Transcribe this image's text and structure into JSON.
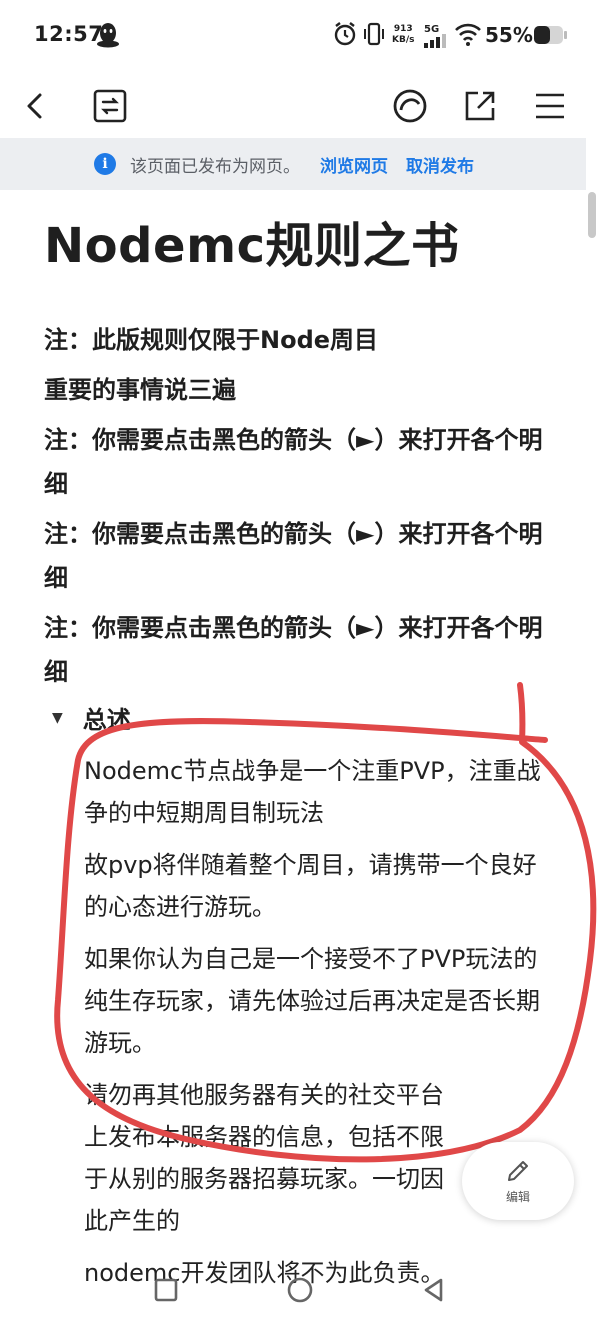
{
  "status_bar": {
    "time": "12:57",
    "net_speed": "913",
    "net_unit": "KB/s",
    "signal_label": "5G",
    "battery": "55%"
  },
  "toolbar": {
    "back_icon": "chevron-left-icon",
    "reader_icon": "reader-mode-icon",
    "ai_icon": "assistant-icon",
    "share_icon": "open-external-icon",
    "menu_icon": "menu-icon"
  },
  "banner": {
    "message": "该页面已发布为网页。",
    "browse_link": "浏览网页",
    "unpublish_link": "取消发布",
    "accent_color": "#1f7ae6"
  },
  "page": {
    "title": "Nodemc规则之书",
    "notes": [
      "注：此版规则仅限于Node周目",
      "重要的事情说三遍",
      "注：你需要点击黑色的箭头（►）来打开各个明细",
      "注：你需要点击黑色的箭头（►）来打开各个明细",
      "注：你需要点击黑色的箭头（►）来打开各个明细"
    ],
    "toggle": {
      "label": "总述",
      "paragraphs": [
        "Nodemc节点战争是一个注重PVP，注重战争的中短期周目制玩法",
        "故pvp将伴随着整个周目，请携带一个良好的心态进行游玩。",
        "如果你认为自己是一个接受不了PVP玩法的纯生存玩家，请先体验过后再决定是否长期游玩。",
        "请勿再其他服务器有关的社交平台上发布本服务器的信息，包括不限于从别的服务器招募玩家。一切因此产生的",
        "nodemc开发团队将不为此负责。"
      ]
    }
  },
  "edit_button": {
    "label": "编辑"
  },
  "annotation_color": "#e04848"
}
